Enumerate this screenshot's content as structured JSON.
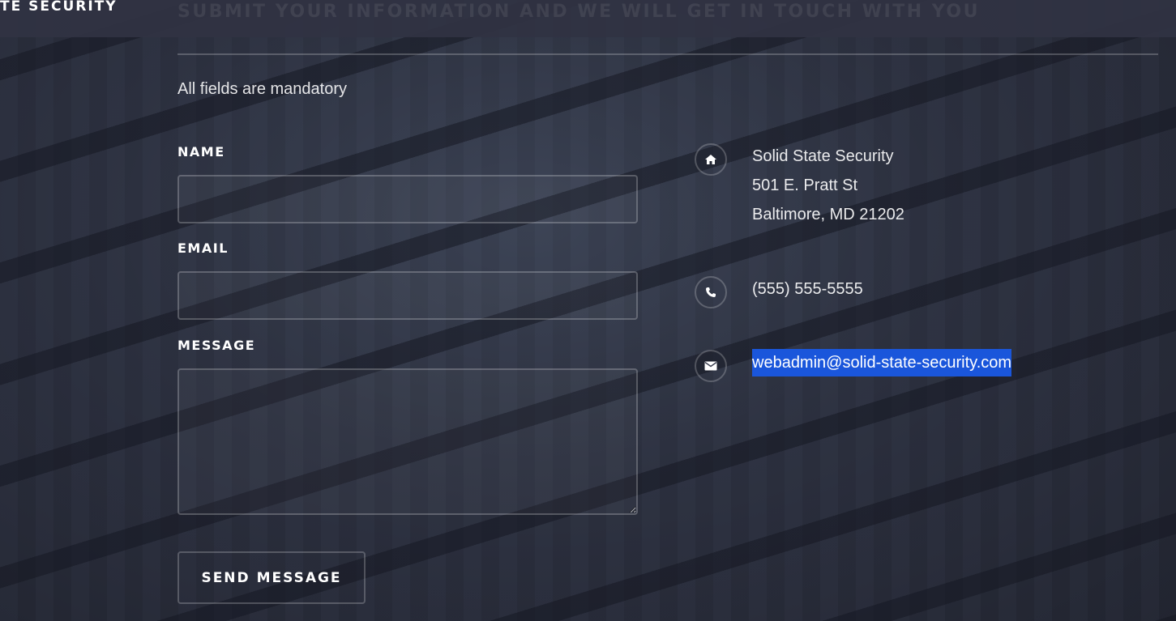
{
  "header": {
    "brand": "TE SECURITY",
    "banner_title": "SUBMIT YOUR INFORMATION AND WE WILL GET IN TOUCH WITH YOU"
  },
  "form": {
    "note": "All fields are mandatory",
    "name_label": "NAME",
    "name_value": "",
    "email_label": "EMAIL",
    "email_value": "",
    "message_label": "MESSAGE",
    "message_value": "",
    "submit_label": "SEND MESSAGE"
  },
  "contact": {
    "address_lines": [
      "Solid State Security",
      "501 E. Pratt St",
      "Baltimore, MD 21202"
    ],
    "phone": "(555) 555-5555",
    "email": "webadmin@solid-state-security.com",
    "icons": [
      "home-icon",
      "phone-icon",
      "envelope-icon"
    ]
  },
  "colors": {
    "background": "#2b2f3d",
    "header": "#303343",
    "selection": "#1a56db",
    "text": "#ffffff"
  }
}
